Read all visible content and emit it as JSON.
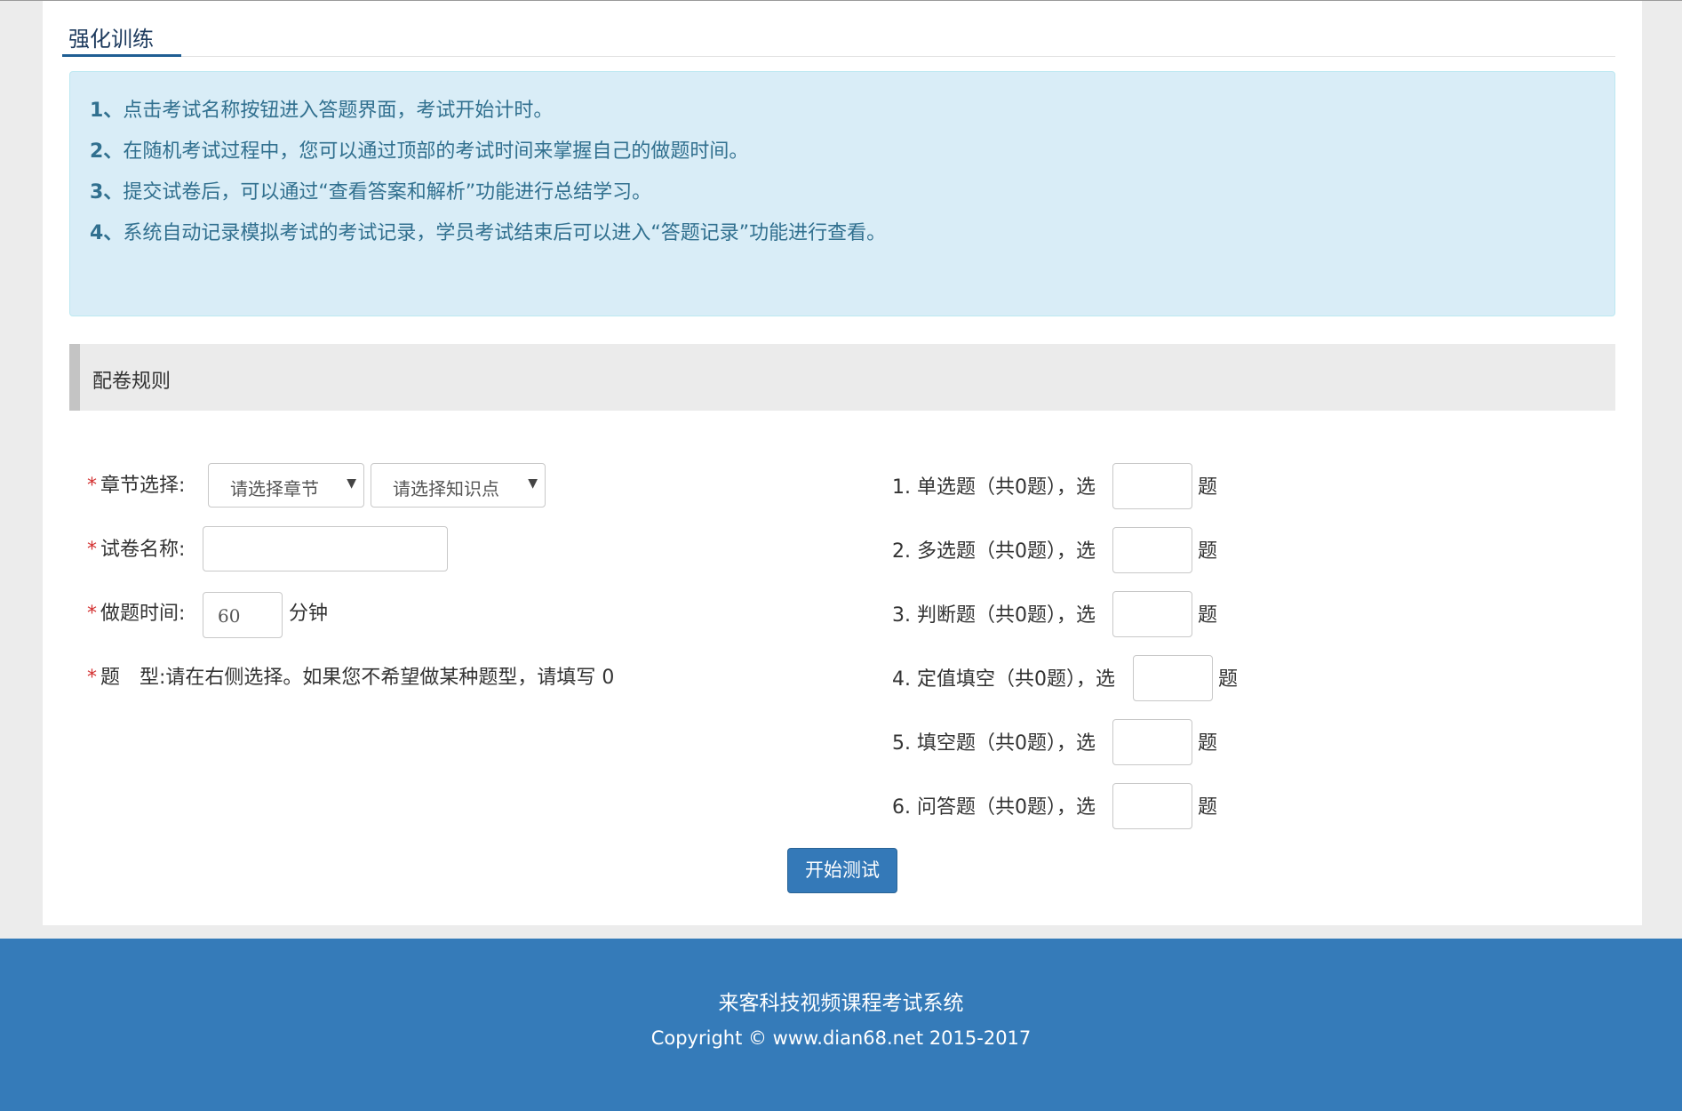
{
  "tabs": {
    "active": "强化训练"
  },
  "instructions": [
    {
      "num": "1、",
      "text": "点击考试名称按钮进入答题界面，考试开始计时。"
    },
    {
      "num": "2、",
      "text": "在随机考试过程中，您可以通过顶部的考试时间来掌握自己的做题时间。"
    },
    {
      "num": "3、",
      "text": "提交试卷后，可以通过“查看答案和解析”功能进行总结学习。"
    },
    {
      "num": "4、",
      "text": "系统自动记录模拟考试的考试记录，学员考试结束后可以进入“答题记录”功能进行查看。"
    }
  ],
  "rules": {
    "title": "配卷规则",
    "required_mark": "*",
    "chapter_label": "章节选择:",
    "chapter_placeholder": "请选择章节",
    "knowledge_placeholder": "请选择知识点",
    "paper_name_label": "试卷名称:",
    "paper_name_value": "",
    "time_label": "做题时间:",
    "time_value": "60",
    "time_unit": "分钟",
    "type_label": "题　型:",
    "type_hint": "请在右侧选择。如果您不希望做某种题型，请填写 0"
  },
  "question_types": [
    {
      "label": "1. 单选题（共0题），选",
      "value": "",
      "suffix": "题"
    },
    {
      "label": "2. 多选题（共0题），选",
      "value": "",
      "suffix": "题"
    },
    {
      "label": "3. 判断题（共0题），选",
      "value": "",
      "suffix": "题"
    },
    {
      "label": "4. 定值填空（共0题），选",
      "value": "",
      "suffix": "题"
    },
    {
      "label": "5. 填空题（共0题），选",
      "value": "",
      "suffix": "题"
    },
    {
      "label": "6. 问答题（共0题），选",
      "value": "",
      "suffix": "题"
    }
  ],
  "start_button": "开始测试",
  "footer": {
    "title": "来客科技视频课程考试系统",
    "copyright": "Copyright © www.dian68.net 2015-2017"
  }
}
